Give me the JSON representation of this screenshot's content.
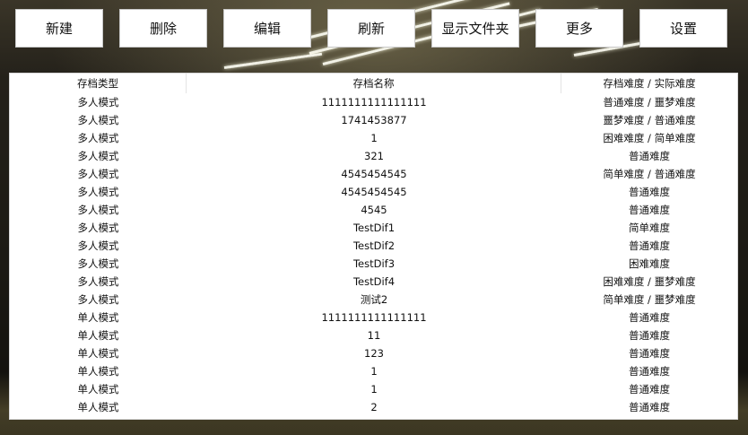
{
  "toolbar": {
    "buttons": [
      "新建",
      "删除",
      "编辑",
      "刷新",
      "显示文件夹",
      "更多",
      "设置"
    ]
  },
  "table": {
    "columns": [
      "存档类型",
      "存档名称",
      "存档难度 / 实际难度"
    ],
    "rows": [
      [
        "多人模式",
        "1111111111111111",
        "普通难度 / 噩梦难度"
      ],
      [
        "多人模式",
        "1741453877",
        "噩梦难度 / 普通难度"
      ],
      [
        "多人模式",
        "1",
        "困难难度 / 简单难度"
      ],
      [
        "多人模式",
        "321",
        "普通难度"
      ],
      [
        "多人模式",
        "4545454545",
        "简单难度 / 普通难度"
      ],
      [
        "多人模式",
        "4545454545",
        "普通难度"
      ],
      [
        "多人模式",
        "4545",
        "普通难度"
      ],
      [
        "多人模式",
        "TestDif1",
        "简单难度"
      ],
      [
        "多人模式",
        "TestDif2",
        "普通难度"
      ],
      [
        "多人模式",
        "TestDif3",
        "困难难度"
      ],
      [
        "多人模式",
        "TestDif4",
        "困难难度 / 噩梦难度"
      ],
      [
        "多人模式",
        "测试2",
        "简单难度 / 噩梦难度"
      ],
      [
        "单人模式",
        "1111111111111111",
        "普通难度"
      ],
      [
        "单人模式",
        "11",
        "普通难度"
      ],
      [
        "单人模式",
        "123",
        "普通难度"
      ],
      [
        "单人模式",
        "1",
        "普通难度"
      ],
      [
        "单人模式",
        "1",
        "普通难度"
      ],
      [
        "单人模式",
        "2",
        "普通难度"
      ]
    ]
  }
}
